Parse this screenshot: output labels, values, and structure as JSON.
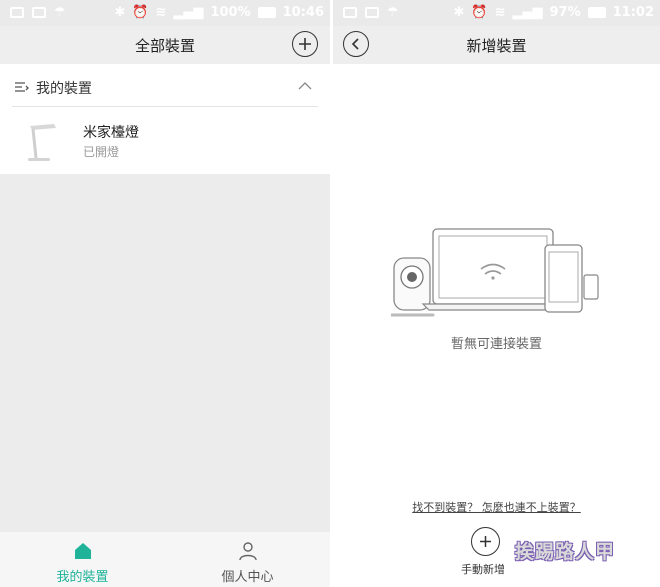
{
  "left": {
    "status": {
      "battery": "100%",
      "time": "10:46"
    },
    "title": "全部裝置",
    "section": {
      "label": "我的裝置"
    },
    "device": {
      "name": "米家檯燈",
      "state": "已開燈"
    },
    "tabs": [
      {
        "label": "我的裝置",
        "icon": "home-icon",
        "active": true
      },
      {
        "label": "個人中心",
        "icon": "person-icon",
        "active": false
      }
    ]
  },
  "right": {
    "status": {
      "battery": "97%",
      "time": "11:02"
    },
    "title": "新增裝置",
    "empty_message": "暫無可連接裝置",
    "help_link": "找不到裝置？ 怎麼也連不上裝置？",
    "manual_add": "手動新增",
    "watermark": "挨踢路人甲"
  },
  "colors": {
    "accent": "#1fb49a",
    "navbar": "#eeeeee",
    "statusbar": "#eaeaea",
    "empty_area": "#ececec"
  }
}
